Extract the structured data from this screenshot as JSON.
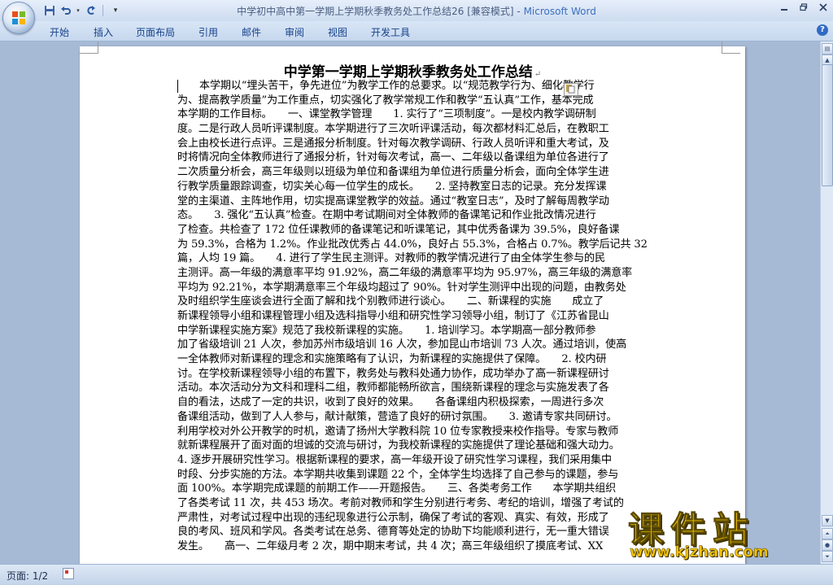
{
  "window": {
    "title_doc": "中学初中高中第一学期上学期秋季教务处工作总结26 [兼容模式] - ",
    "title_app": "Microsoft Word",
    "controls": [
      "minimize-icon",
      "restore-icon",
      "close-icon"
    ]
  },
  "quick_access": [
    "save-icon",
    "undo-icon",
    "redo-icon",
    "customize-icon"
  ],
  "ribbon_tabs": [
    "开始",
    "插入",
    "页面布局",
    "引用",
    "邮件",
    "审阅",
    "视图",
    "开发工具"
  ],
  "document": {
    "title": "中学第一学期上学期秋季教务处工作总结",
    "lines": [
      "本学期以“埋头苦干，争先进位”为教学工作的总要求。以“规范教学行为、细化教学行",
      "为、提高教学质量”为工作重点，切实强化了教学常规工作和教学“五认真”工作，基本完成",
      "本学期的工作目标。　　一、课堂教学管理　　1. 实行了“三项制度”。一是校内教学调研制",
      "度。二是行政人员听评课制度。本学期进行了三次听评课活动，每次都材料汇总后，在教职工",
      "会上由校长进行点评。三是通报分析制度。针对每次教学调研、行政人员听评和重大考试，及",
      "时将情况向全体教师进行了通报分析，针对每次考试，高一、二年级以备课组为单位各进行了",
      "二次质量分析会，高三年级则以班级为单位和备课组为单位进行质量分析会，面向全体学生进",
      "行教学质量跟踪调查，切实关心每一位学生的成长。　　2. 坚持教室日志的记录。充分发挥课",
      "堂的主渠道、主阵地作用，切实提高课堂教学的效益。通过“教室日志”，及时了解每周教学动",
      "态。　　3. 强化“五认真”检查。在期中考试期间对全体教师的备课笔记和作业批改情况进行",
      "了检查。共检查了 172 位任课教师的备课笔记和听课笔记，其中优秀备课为 39.5%，良好备课",
      "为 59.3%，合格为 1.2%。作业批改优秀占 44.0%，良好占 55.3%，合格占 0.7%。教学后记共 3271",
      "篇，人均 19 篇。　　4. 进行了学生民主测评。对教师的教学情况进行了由全体学生参与的民",
      "主测评。高一年级的满意率平均 91.92%，高二年级的满意率平均为 95.97%，高三年级的满意率",
      "平均为 92.21%，本学期满意率三个年级均超过了 90%。针对学生测评中出现的问题，由教务处",
      "及时组织学生座谈会进行全面了解和找个别教师进行谈心。　　二、新课程的实施　　成立了",
      "新课程领导小组和课程管理小组及选科指导小组和研究性学习领导小组，制订了《江苏省昆山",
      "中学新课程实施方案》规范了我校新课程的实施。　　1. 培训学习。本学期高一部分教师参",
      "加了省级培训 21 人次，参加苏州市级培训 16 人次，参加昆山市培训 73 人次。通过培训，使高",
      "一全体教师对新课程的理念和实施策略有了认识，为新课程的实施提供了保障。　　2. 校内研",
      "讨。在学校新课程领导小组的布置下，教务处与教科处通力协作，成功举办了高一新课程研讨",
      "活动。本次活动分为文科和理科二组，教师都能畅所欲言，围绕新课程的理念与实施发表了各",
      "自的看法，达成了一定的共识，收到了良好的效果。　　各备课组内积极探索，一周进行多次",
      "备课组活动，做到了人人参与，献计献策，营造了良好的研讨氛围。　　3. 邀请专家共同研讨。",
      "利用学校对外公开教学的时机，邀请了扬州大学教科院 10 位专家教授来校作指导。专家与教师",
      "就新课程展开了面对面的坦诚的交流与研讨，为我校新课程的实施提供了理论基础和强大动力。",
      "4. 逐步开展研究性学习。根据新课程的要求，高一年级开设了研究性学习课程，我们采用集中",
      "时段、分步实施的方法。本学期共收集到课题 22 个，全体学生均选择了自己参与的课题，参与",
      "面 100%。本学期完成课题的前期工作——开题报告。　　三、各类考务工作　　本学期共组织",
      "了各类考试 11 次，共 453 场次。考前对教师和学生分别进行考务、考纪的培训，增强了考试的",
      "严肃性，对考试过程中出现的违纪现象进行公示制，确保了考试的客观、真实、有效，形成了",
      "良的考风、班风和学风。各类考试在总务、德育等处定的协助下均能顺利进行，无一重大错误",
      "发生。　　高一、二年级月考 2 次，期中期末考试，共 4 次；高三年级组织了摸底考试、XX"
    ]
  },
  "status": {
    "page": "页面: 1/2"
  },
  "watermark": {
    "title": "课件站",
    "url": "www.kjzhan.com"
  },
  "colors": {
    "accent": "#15428b",
    "app_name": "#3b6fc0",
    "watermark": "#f5c400"
  }
}
